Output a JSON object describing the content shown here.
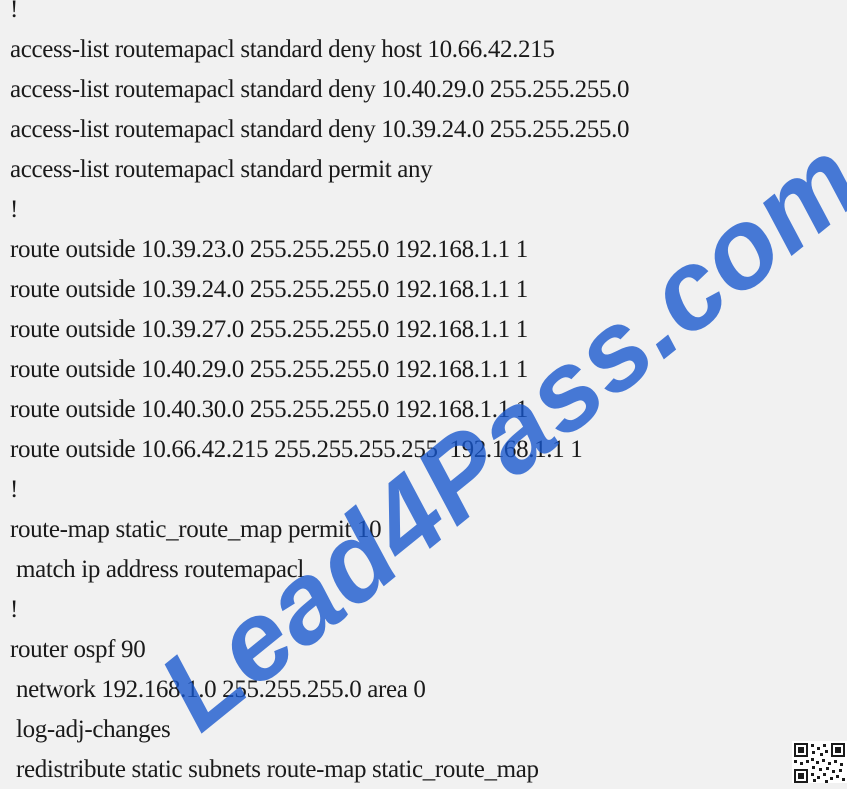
{
  "config_lines": [
    "!",
    "access-list routemapacl standard deny host 10.66.42.215",
    "access-list routemapacl standard deny 10.40.29.0 255.255.255.0",
    "access-list routemapacl standard deny 10.39.24.0 255.255.255.0",
    "access-list routemapacl standard permit any",
    "!",
    "route outside 10.39.23.0 255.255.255.0 192.168.1.1 1",
    "route outside 10.39.24.0 255.255.255.0 192.168.1.1 1",
    "route outside 10.39.27.0 255.255.255.0 192.168.1.1 1",
    "route outside 10.40.29.0 255.255.255.0 192.168.1.1 1",
    "route outside 10.40.30.0 255.255.255.0 192.168.1.1 1",
    "route outside 10.66.42.215 255.255.255.255  192.168.1.1 1",
    "!",
    "route-map static_route_map permit 10",
    "match ip address routemapacl",
    "!",
    "router ospf 90",
    "network 192.168.1.0 255.255.255.0 area 0",
    "log-adj-changes",
    "redistribute static subnets route-map static_route_map"
  ],
  "watermark": "Lead4Pass.com",
  "colors": {
    "background": "#f1f1f1",
    "text": "#1a1a1a",
    "watermark": "#1656cd"
  },
  "icons": {
    "qr": "qr-code-icon"
  }
}
